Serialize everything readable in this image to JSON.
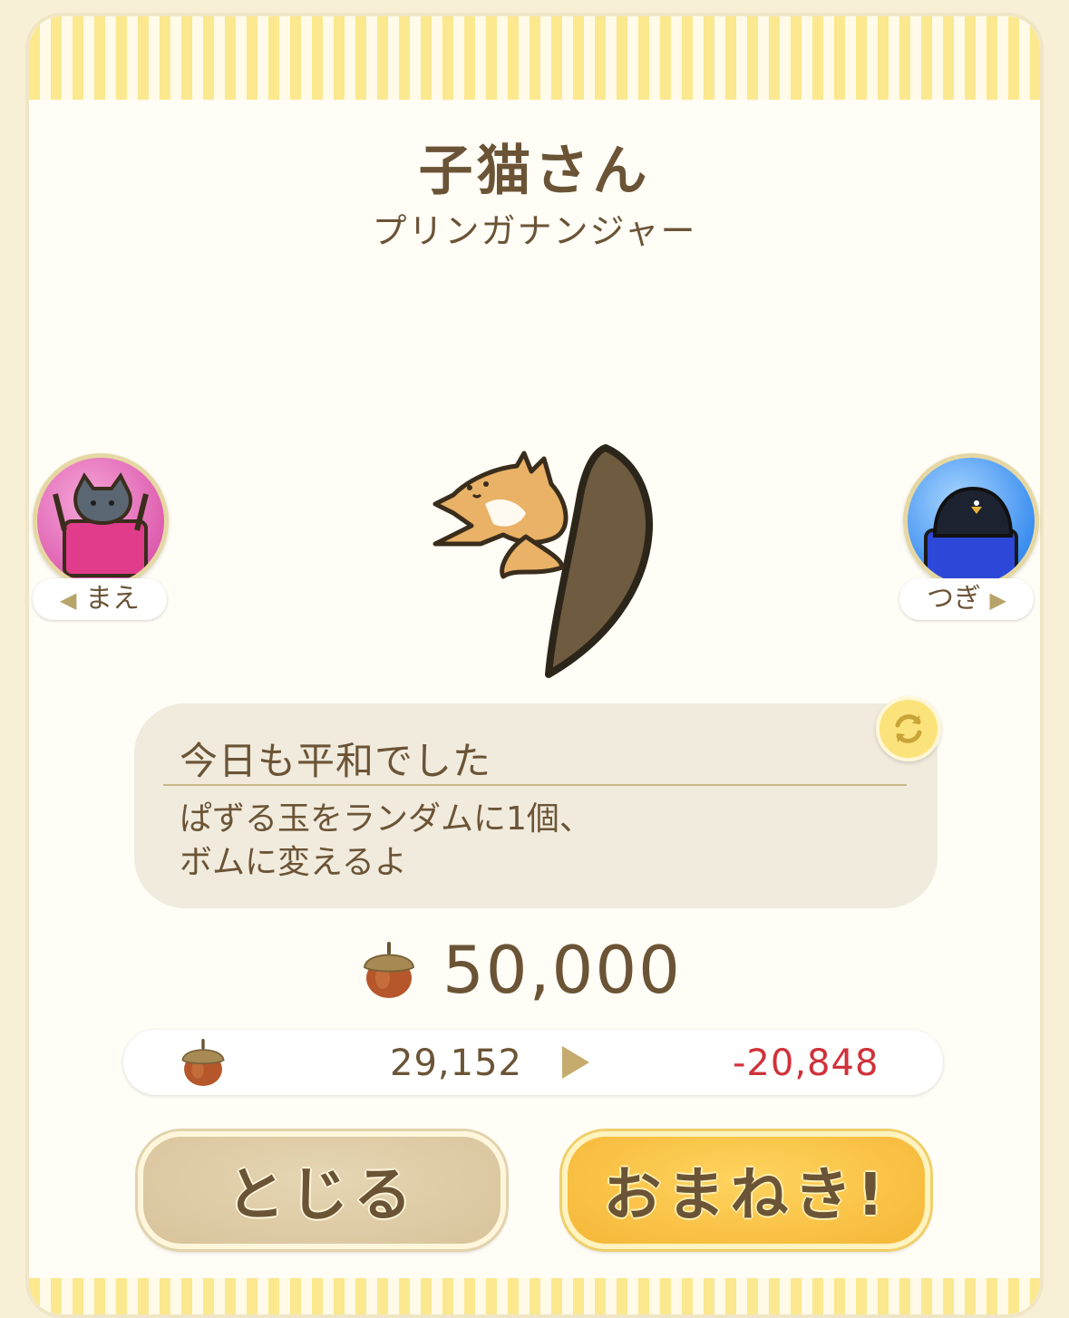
{
  "character": {
    "name": "子猫さん",
    "outfit": "プリンガナンジャー"
  },
  "nav": {
    "prev_label": "まえ",
    "next_label": "つぎ"
  },
  "skill": {
    "title": "今日も平和でした",
    "description_line1": "ぱずる玉をランダムに1個、",
    "description_line2": "ボムに変えるよ"
  },
  "price": {
    "amount": "50,000",
    "currency_icon": "acorn-icon"
  },
  "balance": {
    "current": "29,152",
    "after": "-20,848",
    "after_color": "#d0313a"
  },
  "buttons": {
    "close_label": "とじる",
    "invite_label": "おまねき!"
  },
  "colors": {
    "text": "#6b5436",
    "stripe": "#fbe88f",
    "invite_button": "#f5b637",
    "close_button": "#d8c39a"
  }
}
